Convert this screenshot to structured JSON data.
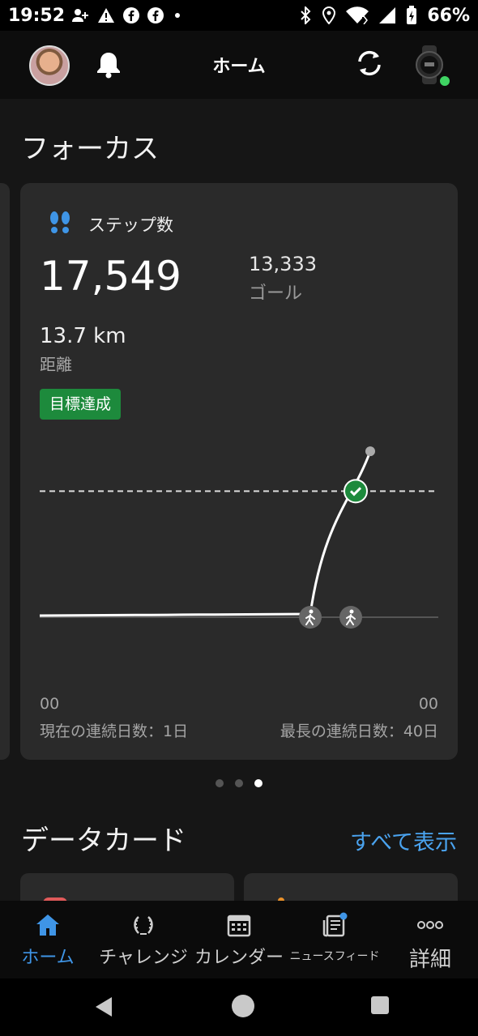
{
  "status_bar": {
    "time": "19:52",
    "battery_percent": "66%",
    "left_icons": [
      "person-add-icon",
      "warning-icon",
      "facebook-icon",
      "facebook-icon",
      "dot-icon"
    ],
    "right_icons": [
      "bluetooth-icon",
      "location-icon",
      "wifi-icon",
      "signal-icon",
      "battery-charging-icon"
    ]
  },
  "app_bar": {
    "title": "ホーム",
    "device_status_color": "#3fd463"
  },
  "focus": {
    "section_title": "フォーカス",
    "card": {
      "label": "ステップ数",
      "steps": "17,549",
      "goal_value": "13,333",
      "goal_label": "ゴール",
      "distance_value": "13.7 km",
      "distance_label": "距離",
      "badge": "目標達成",
      "x_label_left": "00",
      "x_label_right": "00",
      "current_streak": "現在の連続日数：1日",
      "longest_streak": "最長の連続日数：40日"
    },
    "pager": {
      "count": 3,
      "active_index": 2
    }
  },
  "chart_data": {
    "type": "line",
    "x_ticks": [
      "00",
      "00"
    ],
    "goal": 13333,
    "current": 17549,
    "goal_reached": true,
    "series": [
      {
        "values": [
          0,
          0,
          0,
          0,
          0,
          0,
          0,
          0,
          0,
          0,
          0,
          0,
          0,
          0,
          0,
          0,
          0,
          0,
          17549
        ]
      }
    ],
    "ylim": [
      0,
      18500
    ],
    "activity_markers": [
      "walking-icon",
      "walking-icon"
    ]
  },
  "data_cards": {
    "section_title": "データカード",
    "see_all": "すべて表示",
    "accent_colors": [
      "#e05a5a",
      "#e8902a"
    ]
  },
  "bottom_nav": {
    "active_color": "#3f95e6",
    "items": [
      {
        "label": "ホーム",
        "icon": "home-icon",
        "active": true
      },
      {
        "label": "チャレンジ",
        "icon": "laurel-icon",
        "active": false
      },
      {
        "label": "カレンダー",
        "icon": "calendar-icon",
        "active": false
      },
      {
        "label": "ニュースフィード",
        "icon": "newsfeed-icon",
        "active": false
      },
      {
        "label": "詳細",
        "icon": "more-icon",
        "active": false
      }
    ]
  }
}
